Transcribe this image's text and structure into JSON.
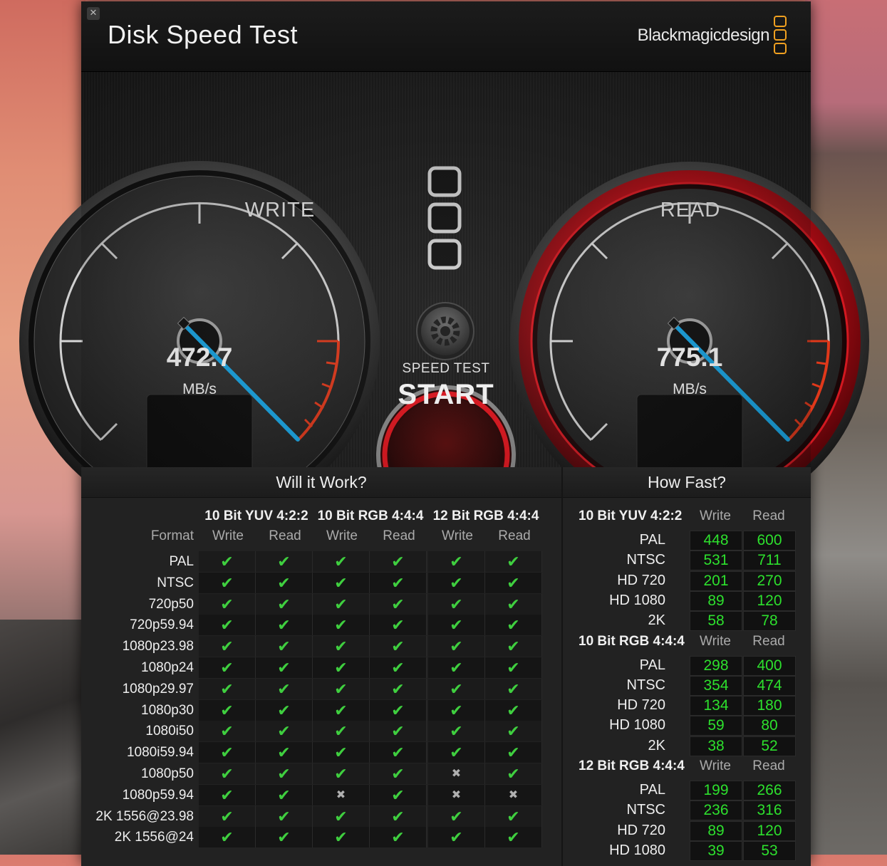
{
  "window": {
    "title": "Disk Speed Test",
    "brand": "Blackmagicdesign",
    "close_symbol": "✕"
  },
  "gauges": {
    "write": {
      "label": "WRITE",
      "value": "472.7",
      "unit": "MB/s",
      "needle_fraction": 0.72
    },
    "read": {
      "label": "READ",
      "value": "775.1",
      "unit": "MB/s",
      "needle_fraction": 0.72
    }
  },
  "start_button": {
    "top_label": "SPEED TEST",
    "label": "START"
  },
  "will_it_work": {
    "title": "Will it Work?",
    "format_header": "Format",
    "groups": [
      "10 Bit YUV 4:2:2",
      "10 Bit RGB 4:4:4",
      "12 Bit RGB 4:4:4"
    ],
    "subheaders": [
      "Write",
      "Read",
      "Write",
      "Read",
      "Write",
      "Read"
    ],
    "rows": [
      {
        "format": "PAL",
        "cells": [
          "ok",
          "ok",
          "ok",
          "ok",
          "ok",
          "ok"
        ]
      },
      {
        "format": "NTSC",
        "cells": [
          "ok",
          "ok",
          "ok",
          "ok",
          "ok",
          "ok"
        ]
      },
      {
        "format": "720p50",
        "cells": [
          "ok",
          "ok",
          "ok",
          "ok",
          "ok",
          "ok"
        ]
      },
      {
        "format": "720p59.94",
        "cells": [
          "ok",
          "ok",
          "ok",
          "ok",
          "ok",
          "ok"
        ]
      },
      {
        "format": "1080p23.98",
        "cells": [
          "ok",
          "ok",
          "ok",
          "ok",
          "ok",
          "ok"
        ]
      },
      {
        "format": "1080p24",
        "cells": [
          "ok",
          "ok",
          "ok",
          "ok",
          "ok",
          "ok"
        ]
      },
      {
        "format": "1080p29.97",
        "cells": [
          "ok",
          "ok",
          "ok",
          "ok",
          "ok",
          "ok"
        ]
      },
      {
        "format": "1080p30",
        "cells": [
          "ok",
          "ok",
          "ok",
          "ok",
          "ok",
          "ok"
        ]
      },
      {
        "format": "1080i50",
        "cells": [
          "ok",
          "ok",
          "ok",
          "ok",
          "ok",
          "ok"
        ]
      },
      {
        "format": "1080i59.94",
        "cells": [
          "ok",
          "ok",
          "ok",
          "ok",
          "ok",
          "ok"
        ]
      },
      {
        "format": "1080p50",
        "cells": [
          "ok",
          "ok",
          "ok",
          "ok",
          "no",
          "ok"
        ]
      },
      {
        "format": "1080p59.94",
        "cells": [
          "ok",
          "ok",
          "no",
          "ok",
          "no",
          "no"
        ]
      },
      {
        "format": "2K 1556@23.98",
        "cells": [
          "ok",
          "ok",
          "ok",
          "ok",
          "ok",
          "ok"
        ]
      },
      {
        "format": "2K 1556@24",
        "cells": [
          "ok",
          "ok",
          "ok",
          "ok",
          "ok",
          "ok"
        ]
      }
    ]
  },
  "how_fast": {
    "title": "How Fast?",
    "write_label": "Write",
    "read_label": "Read",
    "groups": [
      {
        "name": "10 Bit YUV 4:2:2",
        "rows": [
          {
            "format": "PAL",
            "write": "448",
            "read": "600"
          },
          {
            "format": "NTSC",
            "write": "531",
            "read": "711"
          },
          {
            "format": "HD 720",
            "write": "201",
            "read": "270"
          },
          {
            "format": "HD 1080",
            "write": "89",
            "read": "120"
          },
          {
            "format": "2K",
            "write": "58",
            "read": "78"
          }
        ]
      },
      {
        "name": "10 Bit RGB 4:4:4",
        "rows": [
          {
            "format": "PAL",
            "write": "298",
            "read": "400"
          },
          {
            "format": "NTSC",
            "write": "354",
            "read": "474"
          },
          {
            "format": "HD 720",
            "write": "134",
            "read": "180"
          },
          {
            "format": "HD 1080",
            "write": "59",
            "read": "80"
          },
          {
            "format": "2K",
            "write": "38",
            "read": "52"
          }
        ]
      },
      {
        "name": "12 Bit RGB 4:4:4",
        "rows": [
          {
            "format": "PAL",
            "write": "199",
            "read": "266"
          },
          {
            "format": "NTSC",
            "write": "236",
            "read": "316"
          },
          {
            "format": "HD 720",
            "write": "89",
            "read": "120"
          },
          {
            "format": "HD 1080",
            "write": "39",
            "read": "53"
          }
        ]
      }
    ]
  },
  "symbols": {
    "ok": "✔",
    "no": "✖"
  },
  "colors": {
    "accent_orange": "#f0a020",
    "needle": "#19a8e8",
    "value_green": "#2de02d",
    "check_green": "#3fcf3f",
    "read_ring": "#c0101a",
    "redline": "#e0381a"
  }
}
